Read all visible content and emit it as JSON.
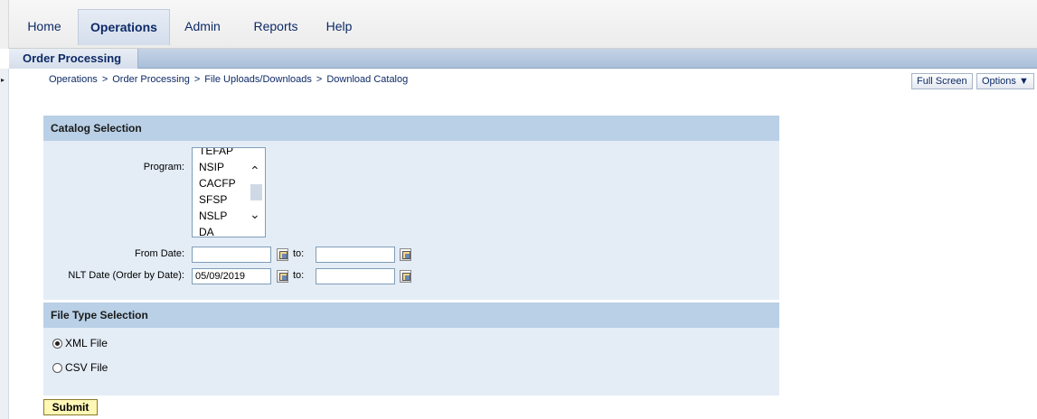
{
  "nav": {
    "tabs": [
      {
        "label": "Home"
      },
      {
        "label": "Operations"
      },
      {
        "label": "Admin"
      },
      {
        "label": "Reports"
      },
      {
        "label": "Help"
      }
    ],
    "subtab": "Order Processing"
  },
  "breadcrumb": {
    "items": [
      "Operations",
      "Order Processing",
      "File Uploads/Downloads",
      "Download Catalog"
    ],
    "separator": ">"
  },
  "toolbar": {
    "full_screen": "Full Screen",
    "options": "Options ▼"
  },
  "catalog": {
    "title": "Catalog Selection",
    "program_label": "Program:",
    "programs": [
      "TEFAP",
      "NSIP",
      "CACFP",
      "SFSP",
      "NSLP",
      "DA"
    ],
    "from_date_label": "From Date:",
    "from_date_value": "",
    "to_label": "to:",
    "to_date_value": "",
    "nlt_label": "NLT Date (Order by Date):",
    "nlt_value": "05/09/2019",
    "nlt_to_value": ""
  },
  "file_type": {
    "title": "File Type Selection",
    "options": [
      {
        "label": "XML File",
        "selected": true
      },
      {
        "label": "CSV File",
        "selected": false
      }
    ]
  },
  "submit_label": "Submit",
  "colors": {
    "section_header": "#b9d0e6",
    "section_body": "#e4edf6",
    "nav_text": "#0d2a66",
    "submit_bg": "#fff7b6"
  }
}
